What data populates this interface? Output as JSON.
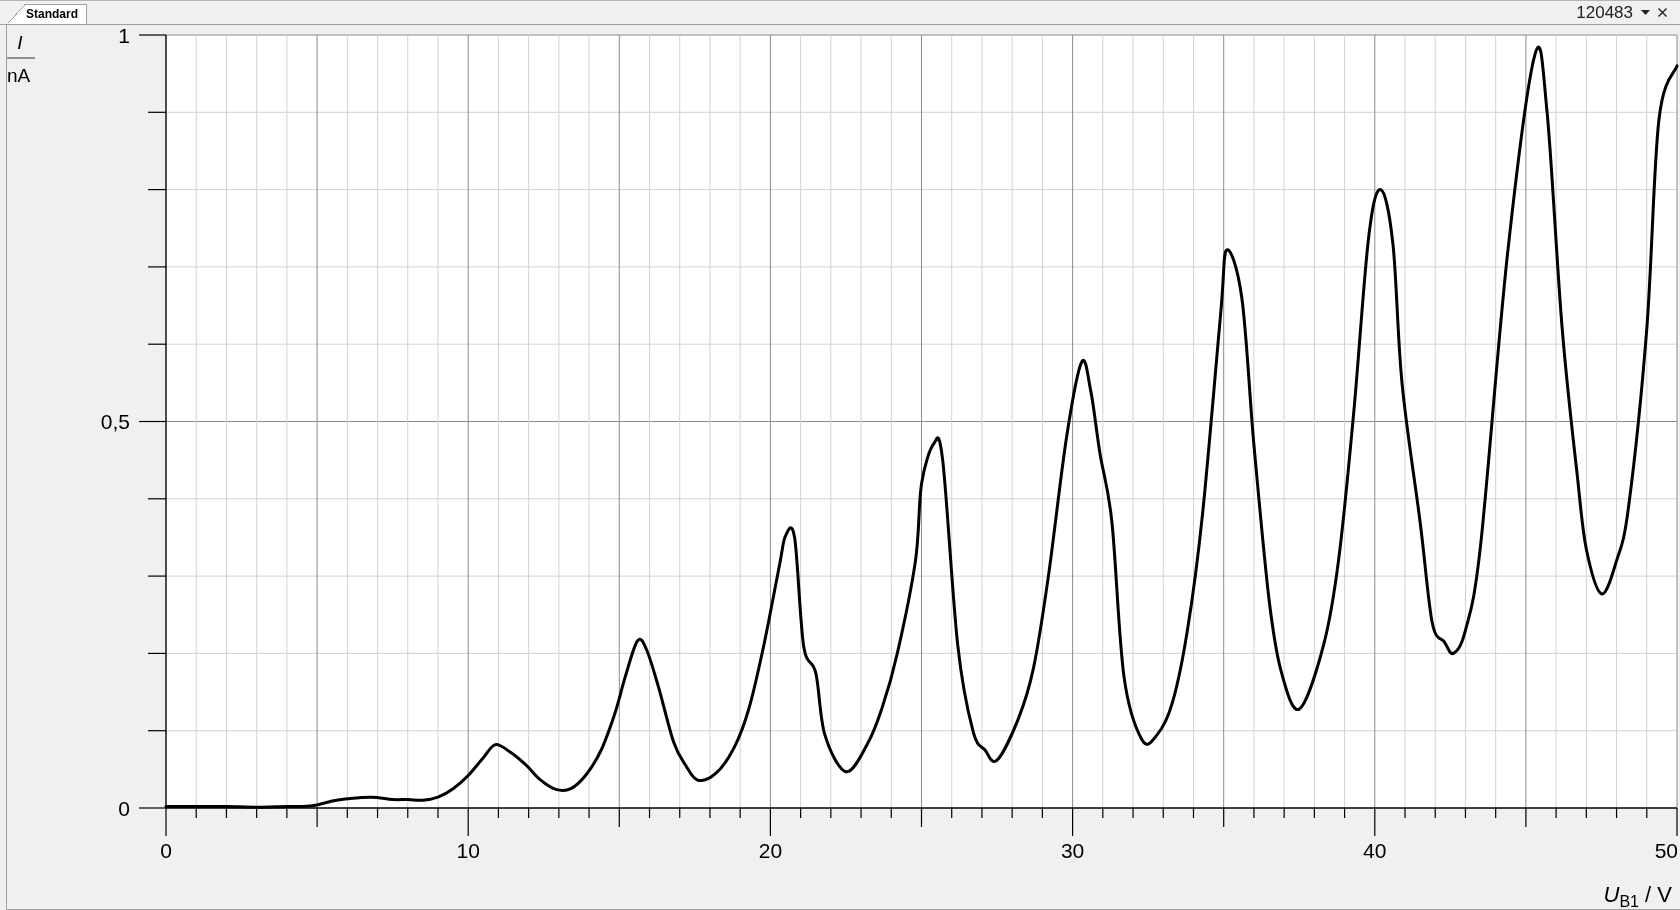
{
  "tabs": [
    {
      "label": "Standard",
      "selected": true
    }
  ],
  "tab_strip_right": {
    "label": "120483"
  },
  "diagram": {
    "y_label": {
      "quantity": "I",
      "unit": "nA"
    },
    "chart_data": {
      "type": "line",
      "xlabel": "*U*$_{B1}$ / V",
      "grid": true,
      "x": [
        0,
        1,
        2,
        3,
        4,
        4.5,
        5,
        5.5,
        6,
        6.8,
        7.5,
        8,
        8.5,
        9,
        9.5,
        10,
        10.5,
        10.9,
        11.4,
        11.9,
        12.4,
        12.9,
        13.4,
        13.9,
        14.4,
        14.85,
        15.2,
        15.6,
        15.9,
        16.3,
        16.8,
        17.2,
        17.6,
        18.2,
        18.8,
        19.3,
        19.8,
        20.3,
        20.5,
        20.8,
        21.1,
        21.5,
        21.8,
        22.5,
        23.2,
        23.7,
        24.2,
        24.8,
        25.0,
        25.4,
        25.7,
        26.2,
        26.7,
        27.1,
        27.5,
        28.2,
        28.7,
        29.2,
        29.8,
        30.3,
        30.6,
        30.9,
        31.3,
        31.7,
        32.3,
        32.8,
        33.3,
        33.8,
        34.3,
        34.9,
        35.1,
        35.6,
        36.0,
        36.5,
        36.9,
        37.5,
        38.3,
        38.8,
        39.3,
        39.8,
        40.2,
        40.6,
        40.9,
        41.5,
        41.9,
        42.3,
        42.6,
        43.0,
        43.5,
        44.4,
        45.3,
        45.7,
        46.2,
        46.7,
        47.0,
        47.5,
        48.0,
        48.4,
        49.0,
        49.4,
        50.0
      ],
      "values": [
        0.002,
        0.002,
        0.002,
        0.001,
        0.002,
        0.002,
        0.004,
        0.009,
        0.012,
        0.014,
        0.011,
        0.011,
        0.01,
        0.014,
        0.025,
        0.042,
        0.065,
        0.082,
        0.072,
        0.056,
        0.036,
        0.024,
        0.025,
        0.043,
        0.075,
        0.122,
        0.17,
        0.216,
        0.205,
        0.156,
        0.085,
        0.055,
        0.036,
        0.045,
        0.078,
        0.13,
        0.214,
        0.314,
        0.352,
        0.35,
        0.21,
        0.175,
        0.095,
        0.047,
        0.082,
        0.13,
        0.2,
        0.32,
        0.419,
        0.471,
        0.45,
        0.21,
        0.1,
        0.075,
        0.062,
        0.115,
        0.18,
        0.3,
        0.48,
        0.577,
        0.54,
        0.46,
        0.37,
        0.17,
        0.088,
        0.095,
        0.136,
        0.23,
        0.38,
        0.64,
        0.722,
        0.66,
        0.47,
        0.27,
        0.177,
        0.128,
        0.21,
        0.32,
        0.51,
        0.74,
        0.8,
        0.73,
        0.55,
        0.37,
        0.24,
        0.215,
        0.2,
        0.23,
        0.34,
        0.72,
        0.975,
        0.9,
        0.62,
        0.43,
        0.335,
        0.277,
        0.32,
        0.39,
        0.62,
        0.89,
        0.96
      ],
      "xlim": [
        0,
        50
      ],
      "ylim": [
        0,
        1
      ],
      "xticks": [
        0,
        10,
        20,
        30,
        40,
        50
      ],
      "yticks": [
        0,
        {
          "value": 0.5,
          "label": "0,5"
        },
        1
      ]
    }
  }
}
